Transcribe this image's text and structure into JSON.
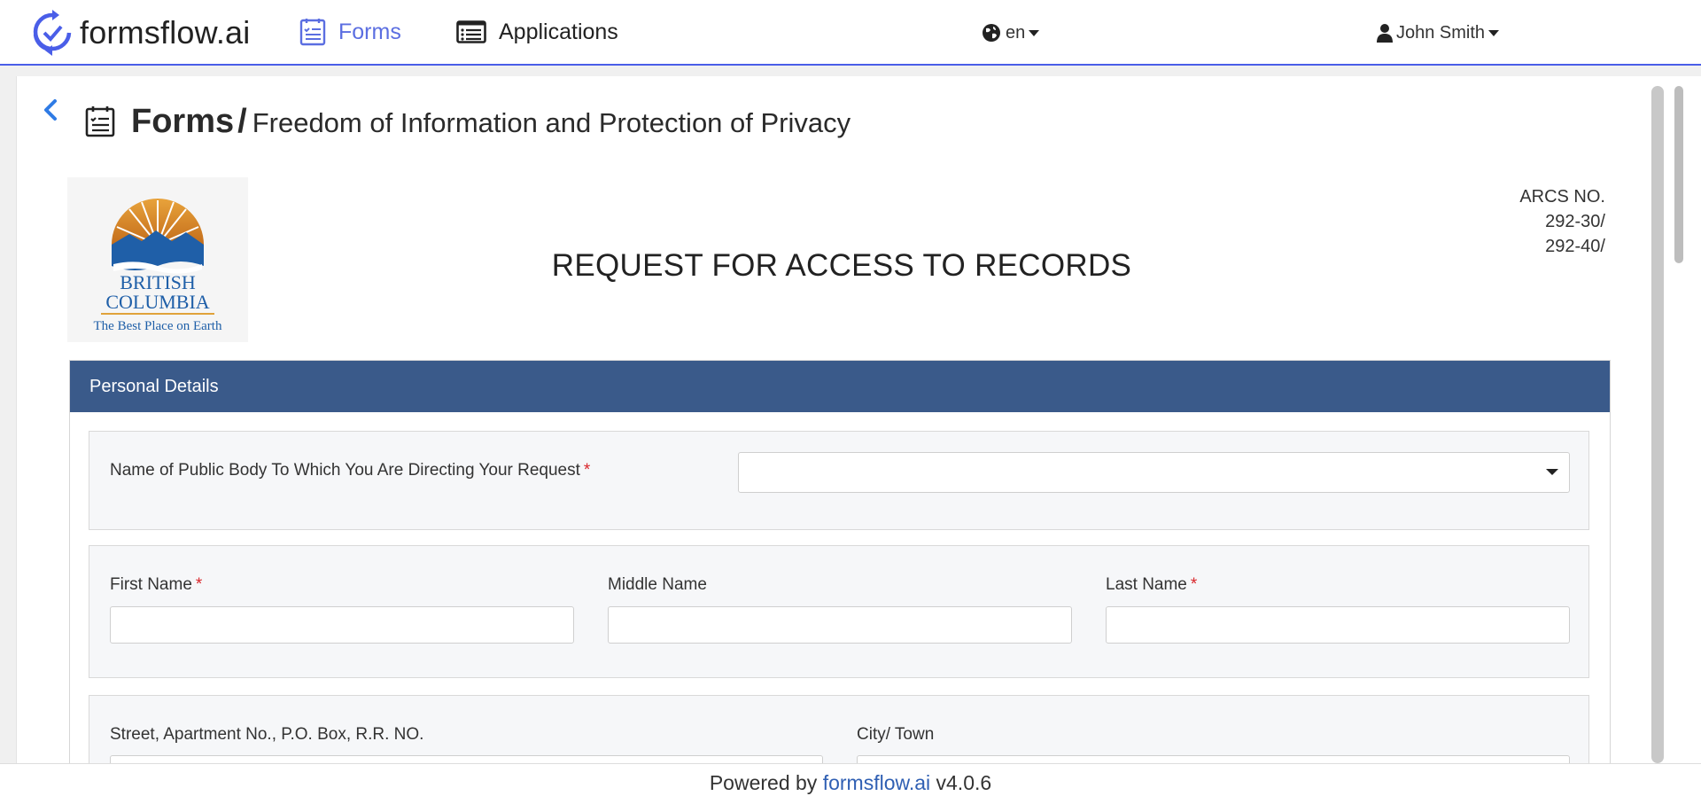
{
  "header": {
    "brand": "formsflow.ai",
    "nav": [
      {
        "label": "Forms",
        "icon": "form-list-icon",
        "active": true
      },
      {
        "label": "Applications",
        "icon": "list-icon",
        "active": false
      }
    ],
    "language": "en",
    "user": "John Smith",
    "accent_color": "#5b6ee1"
  },
  "page": {
    "title": "Forms",
    "separator": "/",
    "subtitle": "Freedom of Information and Protection of Privacy"
  },
  "document": {
    "logo_lines": [
      "BRITISH",
      "COLUMBIA",
      "The Best Place on Earth"
    ],
    "title": "REQUEST FOR ACCESS TO RECORDS",
    "arcs": [
      "ARCS NO.",
      "292-30/",
      "292-40/"
    ]
  },
  "panel": {
    "heading": "Personal Details",
    "heading_color": "#3a5a8a"
  },
  "fields": {
    "public_body": {
      "label": "Name of Public Body To Which You Are Directing Your Request",
      "required_mark": "*",
      "value": ""
    },
    "first_name": {
      "label": "First Name",
      "required_mark": "*",
      "value": ""
    },
    "middle_name": {
      "label": "Middle Name",
      "value": ""
    },
    "last_name": {
      "label": "Last Name",
      "required_mark": "*",
      "value": ""
    },
    "street": {
      "label": "Street, Apartment No., P.O. Box, R.R. NO.",
      "value": ""
    },
    "city": {
      "label": "City/ Town",
      "value": ""
    }
  },
  "footer": {
    "prefix": "Powered by",
    "link": "formsflow.ai",
    "version": "v4.0.6"
  }
}
